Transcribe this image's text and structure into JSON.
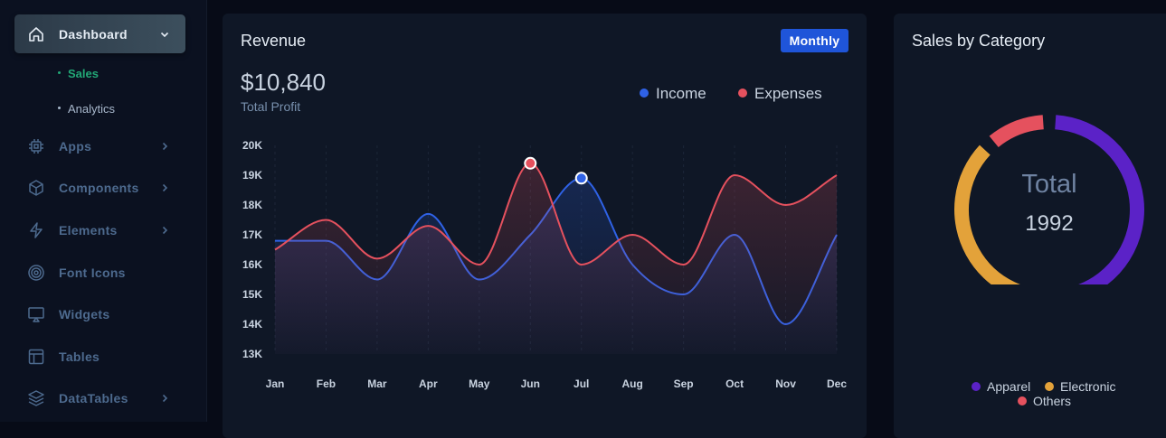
{
  "sidebar": {
    "items": [
      {
        "label": "Dashboard",
        "icon": "home-icon",
        "expanded": true
      },
      {
        "label": "Apps",
        "icon": "cpu-chip-icon"
      },
      {
        "label": "Components",
        "icon": "cube-icon"
      },
      {
        "label": "Elements",
        "icon": "lightning-icon"
      },
      {
        "label": "Font Icons",
        "icon": "target-icon"
      },
      {
        "label": "Widgets",
        "icon": "screen-icon"
      },
      {
        "label": "Tables",
        "icon": "table-icon"
      },
      {
        "label": "DataTables",
        "icon": "layers-icon"
      }
    ],
    "dashboard_sub": [
      {
        "label": "Sales",
        "active": true
      },
      {
        "label": "Analytics",
        "active": false
      }
    ]
  },
  "revenue": {
    "title": "Revenue",
    "period_badge": "Monthly",
    "total_value": "$10,840",
    "total_label": "Total Profit",
    "legend": [
      {
        "name": "Income",
        "color": "#2f62e6"
      },
      {
        "name": "Expenses",
        "color": "#e5515e"
      }
    ]
  },
  "sales_by_category": {
    "title": "Sales by Category",
    "center_label": "Total",
    "center_value": "1992",
    "legend": [
      {
        "name": "Apparel",
        "color": "#5b22c7"
      },
      {
        "name": "Electronic",
        "color": "#e3a23a"
      },
      {
        "name": "Others",
        "color": "#e5515e"
      }
    ]
  },
  "chart_data": [
    {
      "type": "area",
      "categories": [
        "Jan",
        "Feb",
        "Mar",
        "Apr",
        "May",
        "Jun",
        "Jul",
        "Aug",
        "Sep",
        "Oct",
        "Nov",
        "Dec"
      ],
      "series": [
        {
          "name": "Income",
          "color": "#2f62e6",
          "values": [
            16800,
            16800,
            15500,
            17700,
            15500,
            17000,
            18900,
            16000,
            15000,
            17000,
            14000,
            17000
          ]
        },
        {
          "name": "Expenses",
          "color": "#e5515e",
          "values": [
            16500,
            17500,
            16200,
            17300,
            16000,
            19400,
            16000,
            17000,
            16000,
            19000,
            18000,
            19000
          ]
        }
      ],
      "markers": [
        {
          "series": "Expenses",
          "category": "Jun",
          "value": 19400
        },
        {
          "series": "Income",
          "category": "Jul",
          "value": 18900
        }
      ],
      "y_ticks": [
        "20K",
        "19K",
        "18K",
        "17K",
        "16K",
        "15K",
        "14K",
        "13K"
      ],
      "ylim": [
        13000,
        20000
      ],
      "grid": "vertical dashed"
    },
    {
      "type": "pie",
      "labels": [
        "Apparel",
        "Electronic",
        "Others"
      ],
      "values": [
        46,
        42,
        12
      ],
      "colors": [
        "#5b22c7",
        "#e3a23a",
        "#e5515e"
      ]
    }
  ]
}
